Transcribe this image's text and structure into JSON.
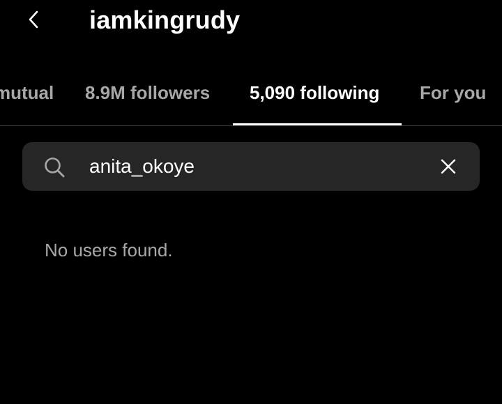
{
  "header": {
    "username": "iamkingrudy",
    "back_icon": "chevron-left-icon"
  },
  "tabs": [
    {
      "label": "mutual",
      "active": false
    },
    {
      "label": "8.9M followers",
      "active": false
    },
    {
      "label": "5,090 following",
      "active": true
    },
    {
      "label": "For you",
      "active": false
    }
  ],
  "search": {
    "value": "anita_okoye",
    "search_icon": "search-icon",
    "clear_icon": "close-icon"
  },
  "results": {
    "empty_message": "No users found."
  },
  "colors": {
    "background": "#000000",
    "search_field": "#262626",
    "text_primary": "#ffffff",
    "text_secondary": "#a8a8a8"
  }
}
